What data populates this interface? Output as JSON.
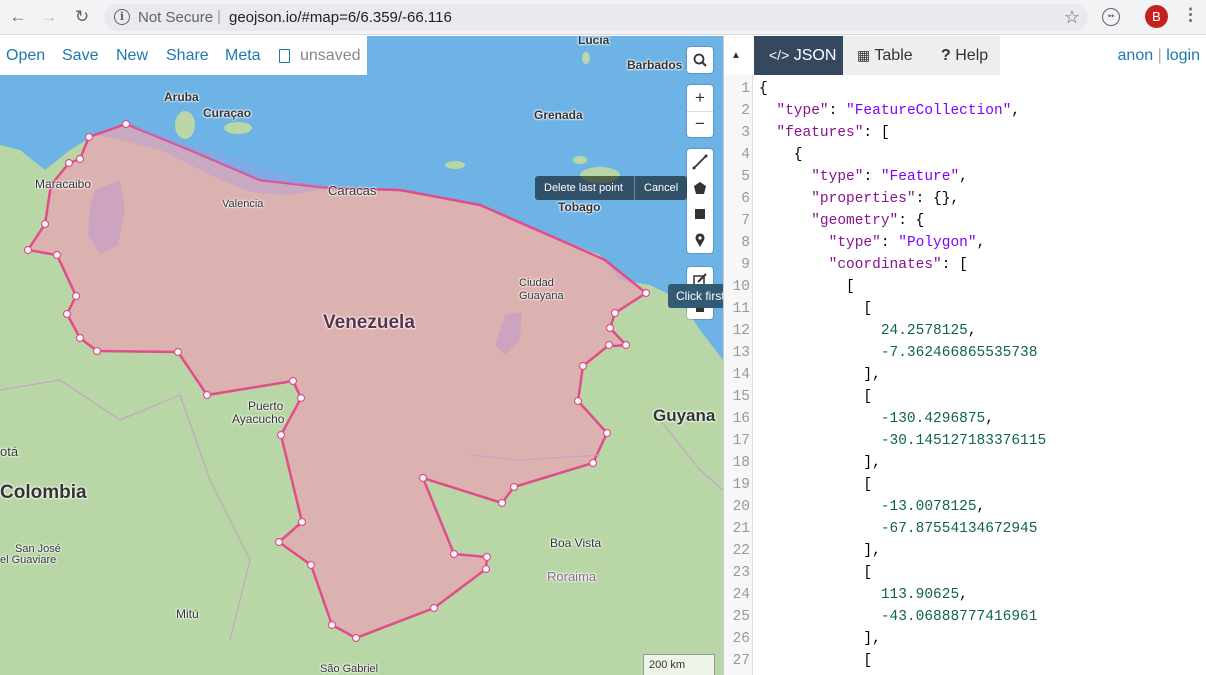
{
  "browser": {
    "security_label": "Not Secure",
    "separator": "|",
    "url": "geojson.io/#map=6/6.359/-66.116",
    "back_icon": "back-arrow-icon",
    "forward_icon": "forward-arrow-icon",
    "reload_icon": "reload-icon",
    "avatar_letter": "B"
  },
  "toolbar": {
    "open": "Open",
    "save": "Save",
    "new": "New",
    "share": "Share",
    "meta": "Meta",
    "status": "unsaved"
  },
  "map": {
    "labels": {
      "lucia": "Lucia",
      "barbados": "Barbados",
      "aruba": "Aruba",
      "curacao": "Curaçao",
      "grenada": "Grenada",
      "maracaibo": "Maracaibo",
      "caracas": "Caracas",
      "valencia": "Valencia",
      "tobago": "Tobago",
      "ciudad_guayana_1": "Ciudad",
      "ciudad_guayana_2": "Guayana",
      "venezuela": "Venezuela",
      "puerto_ayacucho_1": "Puerto",
      "puerto_ayacucho_2": "Ayacucho",
      "guyana": "Guyana",
      "bogota": "otá",
      "colombia": "Colombia",
      "boa_vista": "Boa Vista",
      "roraima": "Roraima",
      "san_jose_1": "San José",
      "san_jose_2": "el Guaviare",
      "mitu": "Mitú",
      "sao_gabriel": "São Gabriel"
    },
    "draw_tooltip": {
      "delete_last": "Delete last point",
      "cancel": "Cancel"
    },
    "partial_tooltip": "Click first",
    "scale": "200 km",
    "colors": {
      "water": "#6db3e6",
      "land": "#b9d7a6",
      "polygon_fill": "#e8a6b4",
      "polygon_stroke": "#e24c8a"
    }
  },
  "panel": {
    "tabs": {
      "json": "JSON",
      "table": "Table",
      "help": "Help"
    },
    "auth": {
      "anon": "anon",
      "sep": "|",
      "login": "login"
    },
    "code_lines": [
      {
        "n": "1",
        "parts": [
          [
            "p",
            "{"
          ]
        ]
      },
      {
        "n": "2",
        "parts": [
          [
            "p",
            "  "
          ],
          [
            "k",
            "\"type\""
          ],
          [
            "p",
            ": "
          ],
          [
            "s",
            "\"FeatureCollection\""
          ],
          [
            "p",
            ","
          ]
        ]
      },
      {
        "n": "3",
        "parts": [
          [
            "p",
            "  "
          ],
          [
            "k",
            "\"features\""
          ],
          [
            "p",
            ": ["
          ]
        ]
      },
      {
        "n": "4",
        "parts": [
          [
            "p",
            "    {"
          ]
        ]
      },
      {
        "n": "5",
        "parts": [
          [
            "p",
            "      "
          ],
          [
            "k",
            "\"type\""
          ],
          [
            "p",
            ": "
          ],
          [
            "s",
            "\"Feature\""
          ],
          [
            "p",
            ","
          ]
        ]
      },
      {
        "n": "6",
        "parts": [
          [
            "p",
            "      "
          ],
          [
            "k",
            "\"properties\""
          ],
          [
            "p",
            ": {},"
          ]
        ]
      },
      {
        "n": "7",
        "parts": [
          [
            "p",
            "      "
          ],
          [
            "k",
            "\"geometry\""
          ],
          [
            "p",
            ": {"
          ]
        ]
      },
      {
        "n": "8",
        "parts": [
          [
            "p",
            "        "
          ],
          [
            "k",
            "\"type\""
          ],
          [
            "p",
            ": "
          ],
          [
            "s",
            "\"Polygon\""
          ],
          [
            "p",
            ","
          ]
        ]
      },
      {
        "n": "9",
        "parts": [
          [
            "p",
            "        "
          ],
          [
            "k",
            "\"coordinates\""
          ],
          [
            "p",
            ": ["
          ]
        ]
      },
      {
        "n": "10",
        "parts": [
          [
            "p",
            "          ["
          ]
        ]
      },
      {
        "n": "11",
        "parts": [
          [
            "p",
            "            ["
          ]
        ]
      },
      {
        "n": "12",
        "parts": [
          [
            "p",
            "              "
          ],
          [
            "n",
            "24.2578125"
          ],
          [
            "p",
            ","
          ]
        ]
      },
      {
        "n": "13",
        "parts": [
          [
            "p",
            "              "
          ],
          [
            "n",
            "-7.362466865535738"
          ]
        ]
      },
      {
        "n": "14",
        "parts": [
          [
            "p",
            "            ],"
          ]
        ]
      },
      {
        "n": "15",
        "parts": [
          [
            "p",
            "            ["
          ]
        ]
      },
      {
        "n": "16",
        "parts": [
          [
            "p",
            "              "
          ],
          [
            "n",
            "-130.4296875"
          ],
          [
            "p",
            ","
          ]
        ]
      },
      {
        "n": "17",
        "parts": [
          [
            "p",
            "              "
          ],
          [
            "n",
            "-30.145127183376115"
          ]
        ]
      },
      {
        "n": "18",
        "parts": [
          [
            "p",
            "            ],"
          ]
        ]
      },
      {
        "n": "19",
        "parts": [
          [
            "p",
            "            ["
          ]
        ]
      },
      {
        "n": "20",
        "parts": [
          [
            "p",
            "              "
          ],
          [
            "n",
            "-13.0078125"
          ],
          [
            "p",
            ","
          ]
        ]
      },
      {
        "n": "21",
        "parts": [
          [
            "p",
            "              "
          ],
          [
            "n",
            "-67.87554134672945"
          ]
        ]
      },
      {
        "n": "22",
        "parts": [
          [
            "p",
            "            ],"
          ]
        ]
      },
      {
        "n": "23",
        "parts": [
          [
            "p",
            "            ["
          ]
        ]
      },
      {
        "n": "24",
        "parts": [
          [
            "p",
            "              "
          ],
          [
            "n",
            "113.90625"
          ],
          [
            "p",
            ","
          ]
        ]
      },
      {
        "n": "25",
        "parts": [
          [
            "p",
            "              "
          ],
          [
            "n",
            "-43.06888777416961"
          ]
        ]
      },
      {
        "n": "26",
        "parts": [
          [
            "p",
            "            ],"
          ]
        ]
      },
      {
        "n": "27",
        "parts": [
          [
            "p",
            "            ["
          ]
        ]
      }
    ]
  }
}
